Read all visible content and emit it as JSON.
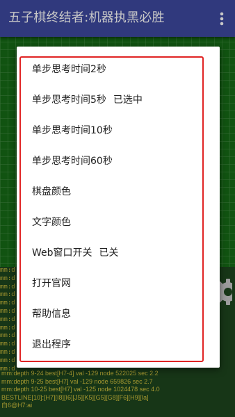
{
  "appbar": {
    "title": "五子棋终结者:机器执黑必胜",
    "more_icon": "more-vertical-icon"
  },
  "menu": {
    "items": [
      {
        "label": "单步思考时间2秒",
        "state": ""
      },
      {
        "label": "单步思考时间5秒",
        "state": "已选中"
      },
      {
        "label": "单步思考时间10秒",
        "state": ""
      },
      {
        "label": "单步思考时间60秒",
        "state": ""
      },
      {
        "label": "棋盘颜色",
        "state": ""
      },
      {
        "label": "文字颜色",
        "state": ""
      },
      {
        "label": "Web窗口开关",
        "state": "已关"
      },
      {
        "label": "打开官网",
        "state": ""
      },
      {
        "label": "帮助信息",
        "state": ""
      },
      {
        "label": "退出程序",
        "state": ""
      }
    ]
  },
  "log": {
    "left_lines": [
      "mm:d",
      "mm:d",
      "mm:d",
      "mm:d",
      "mm:d",
      "mm:d",
      "mm:d",
      "mm:d",
      "mm:d",
      "mm:d",
      "mm:d",
      "mm:d",
      "mm:d"
    ],
    "lines": [
      "mm:depth 9-24 best[H7-4] val -129 node 522025 sec 2.2",
      "mm:depth 9-25 best[H7] val -129 node 659826 sec 2.7",
      "mm:depth 10-25 best[H7] val -125 node 1024478 sec 4.0",
      "BESTLINE[10]:[H7][I8][I6][J5][K5][G5][G8][F6][H9][Ia]",
      "白6@H7:ai"
    ]
  },
  "colors": {
    "appbar": "#3e4aa1",
    "board": "#166b16",
    "log_text": "#d2c23e",
    "highlight_outline": "#e02424"
  },
  "icons": {
    "settings": "gear-icon"
  }
}
